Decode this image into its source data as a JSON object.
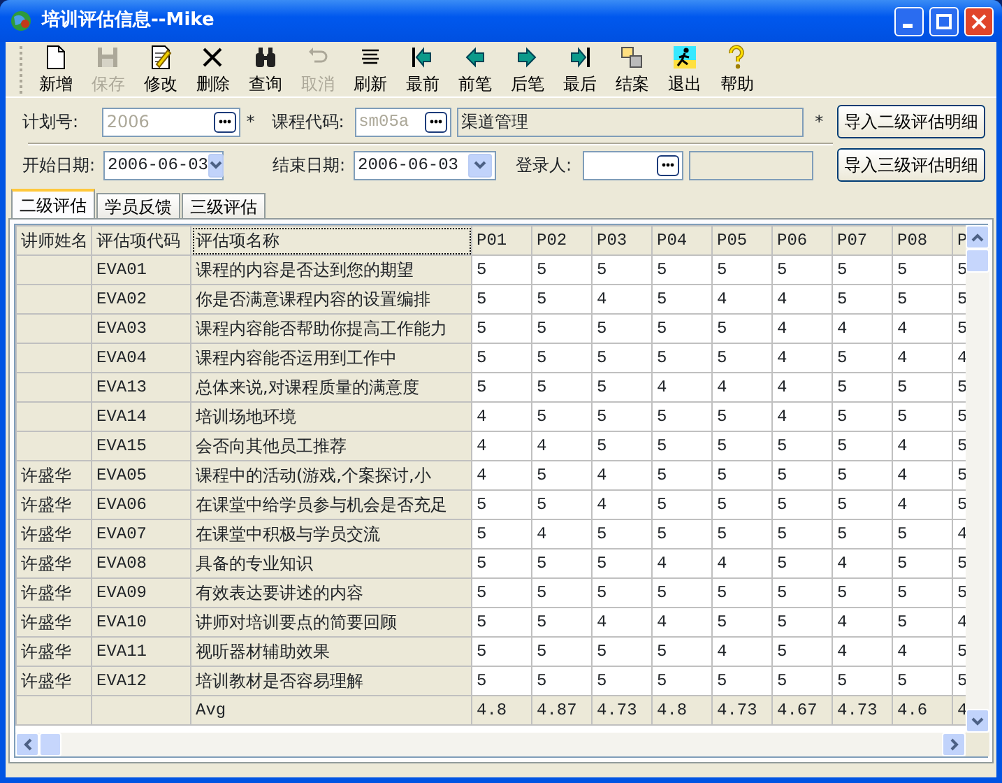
{
  "window": {
    "title": "培训评估信息--Mike"
  },
  "toolbar": [
    {
      "label": "新增",
      "disabled": false
    },
    {
      "label": "保存",
      "disabled": true
    },
    {
      "label": "修改",
      "disabled": false
    },
    {
      "label": "删除",
      "disabled": false
    },
    {
      "label": "查询",
      "disabled": false
    },
    {
      "label": "取消",
      "disabled": true
    },
    {
      "label": "刷新",
      "disabled": false
    },
    {
      "label": "最前",
      "disabled": false
    },
    {
      "label": "前笔",
      "disabled": false
    },
    {
      "label": "后笔",
      "disabled": false
    },
    {
      "label": "最后",
      "disabled": false
    },
    {
      "label": "结案",
      "disabled": false
    },
    {
      "label": "退出",
      "disabled": false
    },
    {
      "label": "帮助",
      "disabled": false
    }
  ],
  "form": {
    "plan_no": {
      "label": "计划号:",
      "value": "2006",
      "disabled": true,
      "required_mark": "*"
    },
    "course_code": {
      "label": "课程代码:",
      "value": "sm05a",
      "disabled": true
    },
    "course_name": {
      "value": "渠道管理",
      "required_mark": "*"
    },
    "start_date": {
      "label": "开始日期:",
      "value": "2006-06-03"
    },
    "end_date": {
      "label": "结束日期:",
      "value": "2006-06-03"
    },
    "recorder": {
      "label": "登录人:"
    },
    "buttons": [
      "导入二级评估明细",
      "导入三级评估明细"
    ]
  },
  "tabs": [
    {
      "label": "二级评估",
      "selected": true
    },
    {
      "label": "学员反馈",
      "selected": false
    },
    {
      "label": "三级评估",
      "selected": false
    }
  ],
  "table": {
    "columns": [
      "讲师姓名",
      "评估项代码",
      "评估项名称",
      "P01",
      "P02",
      "P03",
      "P04",
      "P05",
      "P06",
      "P07",
      "P08",
      "P"
    ],
    "rows": [
      {
        "kind": "item",
        "code": "EVA01",
        "name": "课程的内容是否达到您的期望",
        "scores": [
          "5",
          "5",
          "5",
          "5",
          "5",
          "5",
          "5",
          "5",
          "5"
        ]
      },
      {
        "kind": "item",
        "code": "EVA02",
        "name": "你是否满意课程内容的设置编排",
        "scores": [
          "5",
          "5",
          "4",
          "5",
          "4",
          "4",
          "5",
          "5",
          "5"
        ]
      },
      {
        "kind": "item",
        "code": "EVA03",
        "name": "课程内容能否帮助你提高工作能力",
        "scores": [
          "5",
          "5",
          "5",
          "5",
          "5",
          "4",
          "4",
          "4",
          "5"
        ]
      },
      {
        "kind": "item",
        "code": "EVA04",
        "name": "课程内容能否运用到工作中",
        "scores": [
          "5",
          "5",
          "5",
          "5",
          "5",
          "4",
          "5",
          "4",
          "4"
        ]
      },
      {
        "kind": "item",
        "code": "EVA13",
        "name": "总体来说,对课程质量的满意度",
        "scores": [
          "5",
          "5",
          "5",
          "4",
          "4",
          "4",
          "5",
          "5",
          "5"
        ]
      },
      {
        "kind": "item",
        "code": "EVA14",
        "name": "培训场地环境",
        "scores": [
          "4",
          "5",
          "5",
          "5",
          "5",
          "4",
          "5",
          "5",
          "5"
        ]
      },
      {
        "kind": "item",
        "code": "EVA15",
        "name": "会否向其他员工推荐",
        "scores": [
          "4",
          "4",
          "5",
          "5",
          "5",
          "5",
          "5",
          "4",
          "5"
        ]
      },
      {
        "kind": "item",
        "teacher": "许盛华",
        "code": "EVA05",
        "name": "课程中的活动(游戏,个案探讨,小",
        "scores": [
          "4",
          "5",
          "4",
          "5",
          "5",
          "5",
          "5",
          "4",
          "5"
        ]
      },
      {
        "kind": "item",
        "teacher": "许盛华",
        "code": "EVA06",
        "name": "在课堂中给学员参与机会是否充足",
        "scores": [
          "5",
          "5",
          "4",
          "5",
          "5",
          "5",
          "5",
          "4",
          "5"
        ]
      },
      {
        "kind": "item",
        "teacher": "许盛华",
        "code": "EVA07",
        "name": "在课堂中积极与学员交流",
        "scores": [
          "5",
          "4",
          "5",
          "5",
          "5",
          "5",
          "5",
          "5",
          "4"
        ]
      },
      {
        "kind": "item",
        "teacher": "许盛华",
        "code": "EVA08",
        "name": "具备的专业知识",
        "scores": [
          "5",
          "5",
          "5",
          "4",
          "4",
          "5",
          "4",
          "5",
          "5"
        ]
      },
      {
        "kind": "item",
        "teacher": "许盛华",
        "code": "EVA09",
        "name": "有效表达要讲述的内容",
        "scores": [
          "5",
          "5",
          "5",
          "5",
          "5",
          "5",
          "5",
          "5",
          "5"
        ]
      },
      {
        "kind": "item",
        "teacher": "许盛华",
        "code": "EVA10",
        "name": "讲师对培训要点的简要回顾",
        "scores": [
          "5",
          "5",
          "4",
          "4",
          "5",
          "5",
          "4",
          "5",
          "4"
        ]
      },
      {
        "kind": "item",
        "teacher": "许盛华",
        "code": "EVA11",
        "name": "视听器材辅助效果",
        "scores": [
          "5",
          "5",
          "5",
          "5",
          "4",
          "5",
          "4",
          "4",
          "5"
        ]
      },
      {
        "kind": "item",
        "teacher": "许盛华",
        "code": "EVA12",
        "name": "培训教材是否容易理解",
        "scores": [
          "5",
          "5",
          "5",
          "5",
          "5",
          "5",
          "5",
          "5",
          "5"
        ]
      },
      {
        "kind": "summary",
        "name": "Avg",
        "scores": [
          "4.8",
          "4.87",
          "4.73",
          "4.8",
          "4.73",
          "4.67",
          "4.73",
          "4.6",
          "4"
        ]
      }
    ]
  }
}
